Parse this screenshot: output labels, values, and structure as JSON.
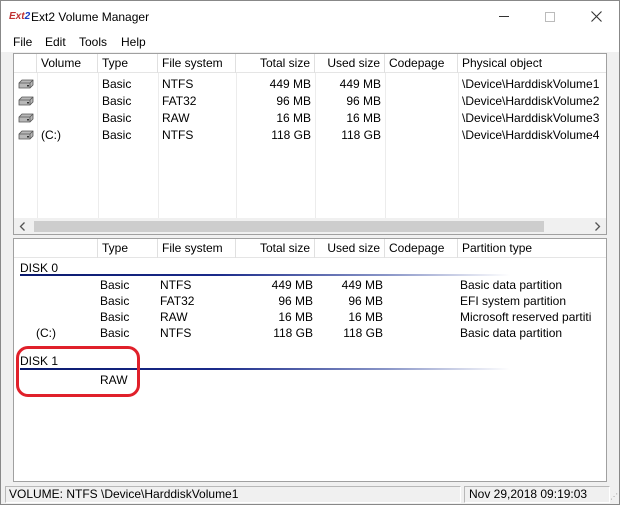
{
  "window": {
    "title": "Ext2 Volume Manager",
    "icon_text_a": "Ext",
    "icon_text_b": "2"
  },
  "menu": [
    "File",
    "Edit",
    "Tools",
    "Help"
  ],
  "volumes_panel": {
    "columns": [
      "Volume",
      "Type",
      "File system",
      "Total size",
      "Used size",
      "Codepage",
      "Physical object"
    ],
    "rows": [
      {
        "volume": "",
        "type": "Basic",
        "fs": "NTFS",
        "total": "449 MB",
        "used": "449 MB",
        "codepage": "",
        "object": "\\Device\\HarddiskVolume1"
      },
      {
        "volume": "",
        "type": "Basic",
        "fs": "FAT32",
        "total": "96 MB",
        "used": "96 MB",
        "codepage": "",
        "object": "\\Device\\HarddiskVolume2"
      },
      {
        "volume": "",
        "type": "Basic",
        "fs": "RAW",
        "total": "16 MB",
        "used": "16 MB",
        "codepage": "",
        "object": "\\Device\\HarddiskVolume3"
      },
      {
        "volume": "(C:)",
        "type": "Basic",
        "fs": "NTFS",
        "total": "118 GB",
        "used": "118 GB",
        "codepage": "",
        "object": "\\Device\\HarddiskVolume4"
      }
    ]
  },
  "disks_panel": {
    "columns": [
      "",
      "Type",
      "File system",
      "Total size",
      "Used size",
      "Codepage",
      "Partition type"
    ],
    "disk0": {
      "label": "DISK 0",
      "rows": [
        {
          "volume": "",
          "type": "Basic",
          "fs": "NTFS",
          "total": "449 MB",
          "used": "449 MB",
          "codepage": "",
          "ptype": "Basic data partition"
        },
        {
          "volume": "",
          "type": "Basic",
          "fs": "FAT32",
          "total": "96 MB",
          "used": "96 MB",
          "codepage": "",
          "ptype": "EFI system partition"
        },
        {
          "volume": "",
          "type": "Basic",
          "fs": "RAW",
          "total": "16 MB",
          "used": "16 MB",
          "codepage": "",
          "ptype": "Microsoft reserved partiti"
        },
        {
          "volume": "(C:)",
          "type": "Basic",
          "fs": "NTFS",
          "total": "118 GB",
          "used": "118 GB",
          "codepage": "",
          "ptype": "Basic data partition"
        }
      ]
    },
    "disk1": {
      "label": "DISK 1",
      "type": "RAW"
    }
  },
  "status": {
    "left": "VOLUME:  NTFS \\Device\\HarddiskVolume1",
    "right": "Nov 29,2018 09:19:03"
  },
  "colors": {
    "annotation": "#e0202a",
    "disk_underline": "#0a1a6e"
  }
}
